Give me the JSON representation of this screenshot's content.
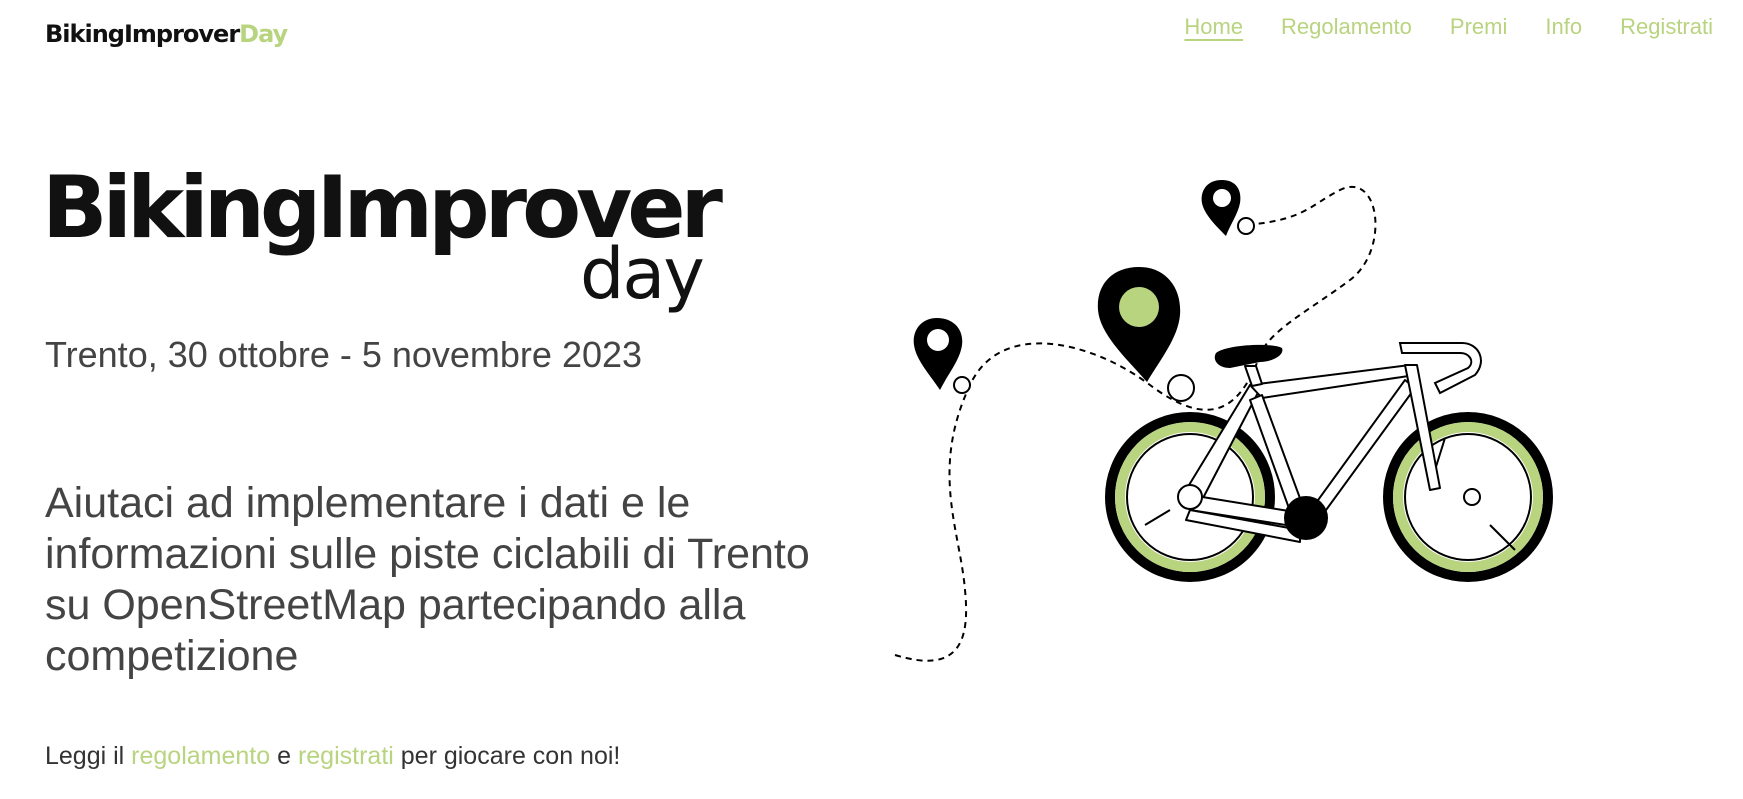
{
  "brand": {
    "name_main": "BikingImprover",
    "name_accent": "Day",
    "accent_color": "#b8d47f",
    "text_color": "#111111"
  },
  "nav": {
    "items": [
      {
        "label": "Home",
        "active": true
      },
      {
        "label": "Regolamento",
        "active": false
      },
      {
        "label": "Premi",
        "active": false
      },
      {
        "label": "Info",
        "active": false
      },
      {
        "label": "Registrati",
        "active": false
      }
    ]
  },
  "hero": {
    "logo_main": "BikingImprover",
    "logo_sub": "day",
    "dates": "Trento, 30 ottobre - 5 novembre 2023",
    "headline": "Aiutaci ad implementare i dati e le informazioni sulle piste ciclabili di Trento su OpenStreetMap partecipando alla competizione",
    "cta": {
      "prefix": "Leggi il ",
      "link1": "regolamento",
      "middle": " e ",
      "link2": "registrati",
      "suffix": " per giocare con noi!"
    }
  },
  "illustration": {
    "icons": [
      "map-pin-icon",
      "bicycle-icon",
      "dashed-route"
    ],
    "colors": {
      "accent": "#b8d47f",
      "ink": "#000000"
    }
  }
}
